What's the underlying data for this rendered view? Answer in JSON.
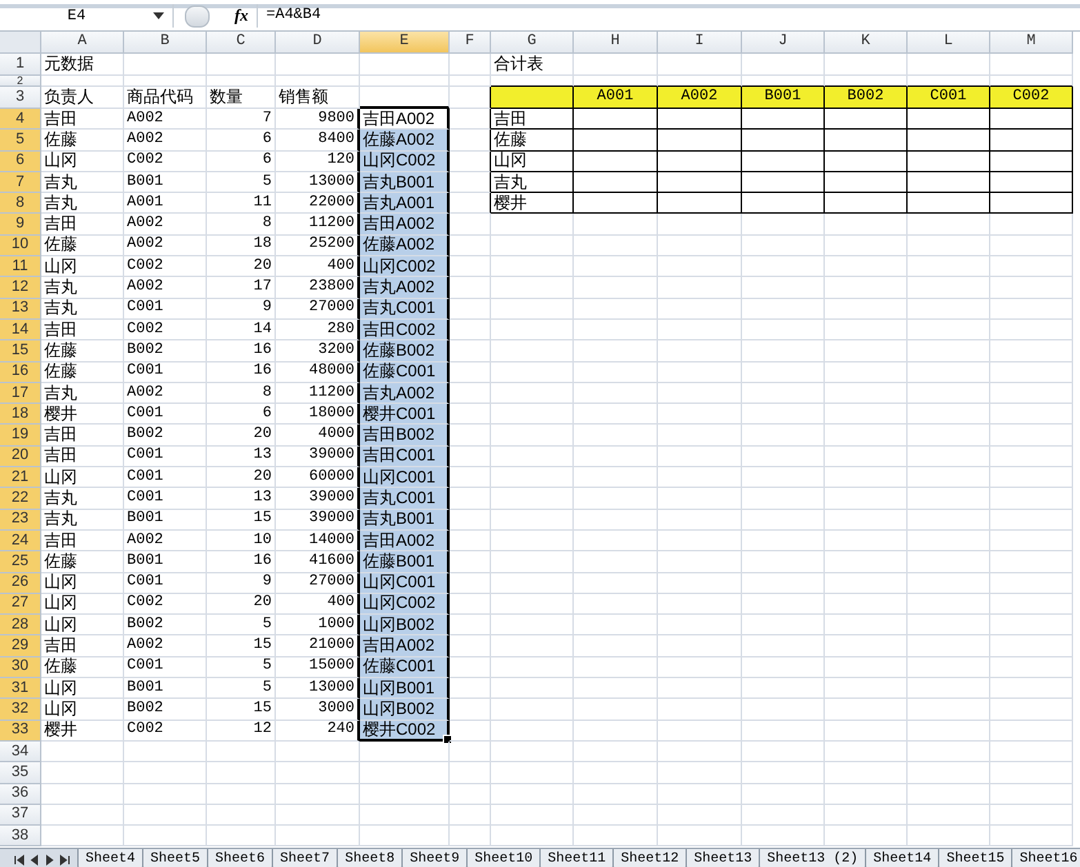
{
  "formula_bar": {
    "name_box": "E4",
    "function_label": "fx",
    "formula": "=A4&B4"
  },
  "sheet": {
    "columns": [
      {
        "label": "A",
        "selected": false
      },
      {
        "label": "B",
        "selected": false
      },
      {
        "label": "C",
        "selected": false
      },
      {
        "label": "D",
        "selected": false
      },
      {
        "label": "E",
        "selected": true
      },
      {
        "label": "F",
        "selected": false
      },
      {
        "label": "G",
        "selected": false
      },
      {
        "label": "H",
        "selected": false
      },
      {
        "label": "I",
        "selected": false
      },
      {
        "label": "J",
        "selected": false
      },
      {
        "label": "K",
        "selected": false
      },
      {
        "label": "L",
        "selected": false
      },
      {
        "label": "M",
        "selected": false
      }
    ],
    "rows": [
      {
        "number": "1",
        "selected": false
      },
      {
        "number": "2",
        "selected": false
      },
      {
        "number": "3",
        "selected": false
      },
      {
        "number": "4",
        "selected": true
      },
      {
        "number": "5",
        "selected": true
      },
      {
        "number": "6",
        "selected": true
      },
      {
        "number": "7",
        "selected": true
      },
      {
        "number": "8",
        "selected": true
      },
      {
        "number": "9",
        "selected": true
      },
      {
        "number": "10",
        "selected": true
      },
      {
        "number": "11",
        "selected": true
      },
      {
        "number": "12",
        "selected": true
      },
      {
        "number": "13",
        "selected": true
      },
      {
        "number": "14",
        "selected": true
      },
      {
        "number": "15",
        "selected": true
      },
      {
        "number": "16",
        "selected": true
      },
      {
        "number": "17",
        "selected": true
      },
      {
        "number": "18",
        "selected": true
      },
      {
        "number": "19",
        "selected": true
      },
      {
        "number": "20",
        "selected": true
      },
      {
        "number": "21",
        "selected": true
      },
      {
        "number": "22",
        "selected": true
      },
      {
        "number": "23",
        "selected": true
      },
      {
        "number": "24",
        "selected": true
      },
      {
        "number": "25",
        "selected": true
      },
      {
        "number": "26",
        "selected": true
      },
      {
        "number": "27",
        "selected": true
      },
      {
        "number": "28",
        "selected": true
      },
      {
        "number": "29",
        "selected": true
      },
      {
        "number": "30",
        "selected": true
      },
      {
        "number": "31",
        "selected": true
      },
      {
        "number": "32",
        "selected": true
      },
      {
        "number": "33",
        "selected": true
      },
      {
        "number": "34",
        "selected": false
      },
      {
        "number": "35",
        "selected": false
      },
      {
        "number": "36",
        "selected": false
      },
      {
        "number": "37",
        "selected": false
      },
      {
        "number": "38",
        "selected": false
      }
    ]
  },
  "source_data": {
    "title": "元数据",
    "headers": [
      "负责人",
      "商品代码",
      "数量",
      "销售额"
    ],
    "rows": [
      {
        "person": "吉田",
        "code": "A002",
        "quantity": "7",
        "amount": "9800",
        "key": "吉田A002",
        "active": true,
        "selected": false
      },
      {
        "person": "佐藤",
        "code": "A002",
        "quantity": "6",
        "amount": "8400",
        "key": "佐藤A002",
        "active": false,
        "selected": true
      },
      {
        "person": "山冈",
        "code": "C002",
        "quantity": "6",
        "amount": "120",
        "key": "山冈C002",
        "active": false,
        "selected": true
      },
      {
        "person": "吉丸",
        "code": "B001",
        "quantity": "5",
        "amount": "13000",
        "key": "吉丸B001",
        "active": false,
        "selected": true
      },
      {
        "person": "吉丸",
        "code": "A001",
        "quantity": "11",
        "amount": "22000",
        "key": "吉丸A001",
        "active": false,
        "selected": true
      },
      {
        "person": "吉田",
        "code": "A002",
        "quantity": "8",
        "amount": "11200",
        "key": "吉田A002",
        "active": false,
        "selected": true
      },
      {
        "person": "佐藤",
        "code": "A002",
        "quantity": "18",
        "amount": "25200",
        "key": "佐藤A002",
        "active": false,
        "selected": true
      },
      {
        "person": "山冈",
        "code": "C002",
        "quantity": "20",
        "amount": "400",
        "key": "山冈C002",
        "active": false,
        "selected": true
      },
      {
        "person": "吉丸",
        "code": "A002",
        "quantity": "17",
        "amount": "23800",
        "key": "吉丸A002",
        "active": false,
        "selected": true
      },
      {
        "person": "吉丸",
        "code": "C001",
        "quantity": "9",
        "amount": "27000",
        "key": "吉丸C001",
        "active": false,
        "selected": true
      },
      {
        "person": "吉田",
        "code": "C002",
        "quantity": "14",
        "amount": "280",
        "key": "吉田C002",
        "active": false,
        "selected": true
      },
      {
        "person": "佐藤",
        "code": "B002",
        "quantity": "16",
        "amount": "3200",
        "key": "佐藤B002",
        "active": false,
        "selected": true
      },
      {
        "person": "佐藤",
        "code": "C001",
        "quantity": "16",
        "amount": "48000",
        "key": "佐藤C001",
        "active": false,
        "selected": true
      },
      {
        "person": "吉丸",
        "code": "A002",
        "quantity": "8",
        "amount": "11200",
        "key": "吉丸A002",
        "active": false,
        "selected": true
      },
      {
        "person": "樱井",
        "code": "C001",
        "quantity": "6",
        "amount": "18000",
        "key": "樱井C001",
        "active": false,
        "selected": true
      },
      {
        "person": "吉田",
        "code": "B002",
        "quantity": "20",
        "amount": "4000",
        "key": "吉田B002",
        "active": false,
        "selected": true
      },
      {
        "person": "吉田",
        "code": "C001",
        "quantity": "13",
        "amount": "39000",
        "key": "吉田C001",
        "active": false,
        "selected": true
      },
      {
        "person": "山冈",
        "code": "C001",
        "quantity": "20",
        "amount": "60000",
        "key": "山冈C001",
        "active": false,
        "selected": true
      },
      {
        "person": "吉丸",
        "code": "C001",
        "quantity": "13",
        "amount": "39000",
        "key": "吉丸C001",
        "active": false,
        "selected": true
      },
      {
        "person": "吉丸",
        "code": "B001",
        "quantity": "15",
        "amount": "39000",
        "key": "吉丸B001",
        "active": false,
        "selected": true
      },
      {
        "person": "吉田",
        "code": "A002",
        "quantity": "10",
        "amount": "14000",
        "key": "吉田A002",
        "active": false,
        "selected": true
      },
      {
        "person": "佐藤",
        "code": "B001",
        "quantity": "16",
        "amount": "41600",
        "key": "佐藤B001",
        "active": false,
        "selected": true
      },
      {
        "person": "山冈",
        "code": "C001",
        "quantity": "9",
        "amount": "27000",
        "key": "山冈C001",
        "active": false,
        "selected": true
      },
      {
        "person": "山冈",
        "code": "C002",
        "quantity": "20",
        "amount": "400",
        "key": "山冈C002",
        "active": false,
        "selected": true
      },
      {
        "person": "山冈",
        "code": "B002",
        "quantity": "5",
        "amount": "1000",
        "key": "山冈B002",
        "active": false,
        "selected": true
      },
      {
        "person": "吉田",
        "code": "A002",
        "quantity": "15",
        "amount": "21000",
        "key": "吉田A002",
        "active": false,
        "selected": true
      },
      {
        "person": "佐藤",
        "code": "C001",
        "quantity": "5",
        "amount": "15000",
        "key": "佐藤C001",
        "active": false,
        "selected": true
      },
      {
        "person": "山冈",
        "code": "B001",
        "quantity": "5",
        "amount": "13000",
        "key": "山冈B001",
        "active": false,
        "selected": true
      },
      {
        "person": "山冈",
        "code": "B002",
        "quantity": "15",
        "amount": "3000",
        "key": "山冈B002",
        "active": false,
        "selected": true
      },
      {
        "person": "樱井",
        "code": "C002",
        "quantity": "12",
        "amount": "240",
        "key": "樱井C002",
        "active": false,
        "selected": true
      }
    ]
  },
  "summary_table": {
    "title": "合计表",
    "columns": [
      "A001",
      "A002",
      "B001",
      "B002",
      "C001",
      "C002"
    ],
    "names": [
      "吉田",
      "佐藤",
      "山冈",
      "吉丸",
      "樱井"
    ]
  },
  "sheet_tabs": [
    {
      "label": "Sheet4",
      "selected": false
    },
    {
      "label": "Sheet5",
      "selected": false
    },
    {
      "label": "Sheet6",
      "selected": false
    },
    {
      "label": "Sheet7",
      "selected": false
    },
    {
      "label": "Sheet8",
      "selected": false
    },
    {
      "label": "Sheet9",
      "selected": false
    },
    {
      "label": "Sheet10",
      "selected": false
    },
    {
      "label": "Sheet11",
      "selected": false
    },
    {
      "label": "Sheet12",
      "selected": false
    },
    {
      "label": "Sheet13",
      "selected": false
    },
    {
      "label": "Sheet13 (2)",
      "selected": false
    },
    {
      "label": "Sheet14",
      "selected": false
    },
    {
      "label": "Sheet15",
      "selected": false
    },
    {
      "label": "Sheet16",
      "selected": false
    }
  ]
}
